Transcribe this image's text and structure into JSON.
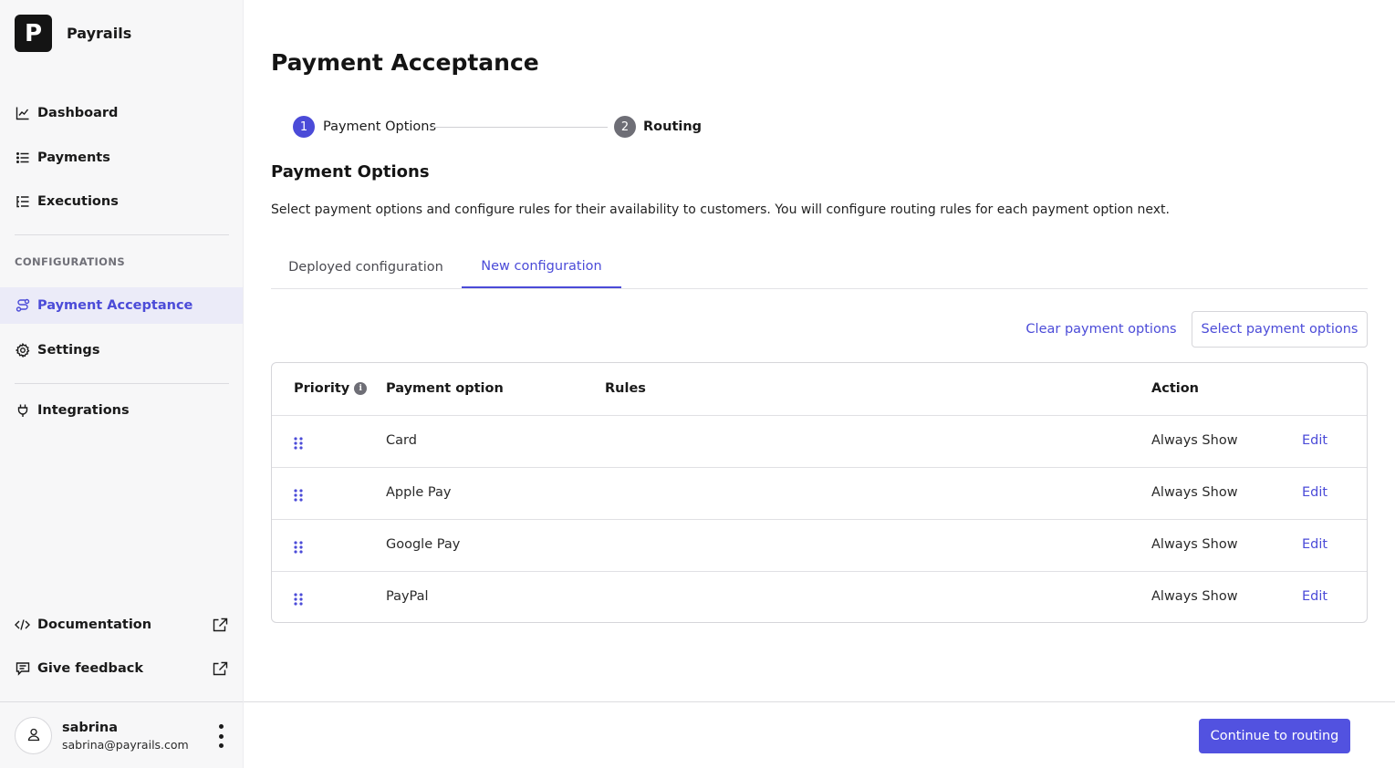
{
  "brand": {
    "name": "Payrails",
    "logo_letter": "P"
  },
  "sidebar": {
    "nav": [
      {
        "label": "Dashboard",
        "icon": "chart-line-icon"
      },
      {
        "label": "Payments",
        "icon": "list-icon"
      },
      {
        "label": "Executions",
        "icon": "tree-list-icon"
      }
    ],
    "section_label": "CONFIGURATIONS",
    "config_nav": [
      {
        "label": "Payment Acceptance",
        "icon": "route-icon",
        "active": true
      },
      {
        "label": "Settings",
        "icon": "gear-icon"
      }
    ],
    "integrations": {
      "label": "Integrations",
      "icon": "plug-icon"
    },
    "bottom_links": [
      {
        "label": "Documentation",
        "icon": "code-icon",
        "trailing_icon": "external-link-icon"
      },
      {
        "label": "Give feedback",
        "icon": "message-icon",
        "trailing_icon": "external-link-icon"
      }
    ],
    "user": {
      "name": "sabrina",
      "email": "sabrina@payrails.com"
    }
  },
  "main": {
    "title": "Payment Acceptance",
    "stepper": [
      {
        "number": "1",
        "label": "Payment Options",
        "state": "active"
      },
      {
        "number": "2",
        "label": "Routing",
        "state": "pending"
      }
    ],
    "section_title": "Payment Options",
    "description": "Select payment options and configure rules for their availability to customers. You will configure routing rules for each payment option next.",
    "tabs": [
      {
        "label": "Deployed configuration",
        "active": false
      },
      {
        "label": "New configuration",
        "active": true
      }
    ],
    "actions": {
      "clear_label": "Clear payment options",
      "select_label": "Select payment options"
    },
    "table": {
      "columns": [
        "Priority",
        "Payment option",
        "Rules",
        "Action"
      ],
      "rows": [
        {
          "option": "Card",
          "rules": "",
          "action": "Always Show",
          "edit": "Edit"
        },
        {
          "option": "Apple Pay",
          "rules": "",
          "action": "Always Show",
          "edit": "Edit"
        },
        {
          "option": "Google Pay",
          "rules": "",
          "action": "Always Show",
          "edit": "Edit"
        },
        {
          "option": "PayPal",
          "rules": "",
          "action": "Always Show",
          "edit": "Edit"
        }
      ]
    },
    "footer": {
      "continue_label": "Continue to routing"
    }
  },
  "colors": {
    "accent": "#4b4bd8",
    "primary_button": "#5252e0",
    "step_inactive": "#6e6e76",
    "sidebar_bg": "#f7f7f8",
    "active_nav_bg": "#ebebf8"
  }
}
